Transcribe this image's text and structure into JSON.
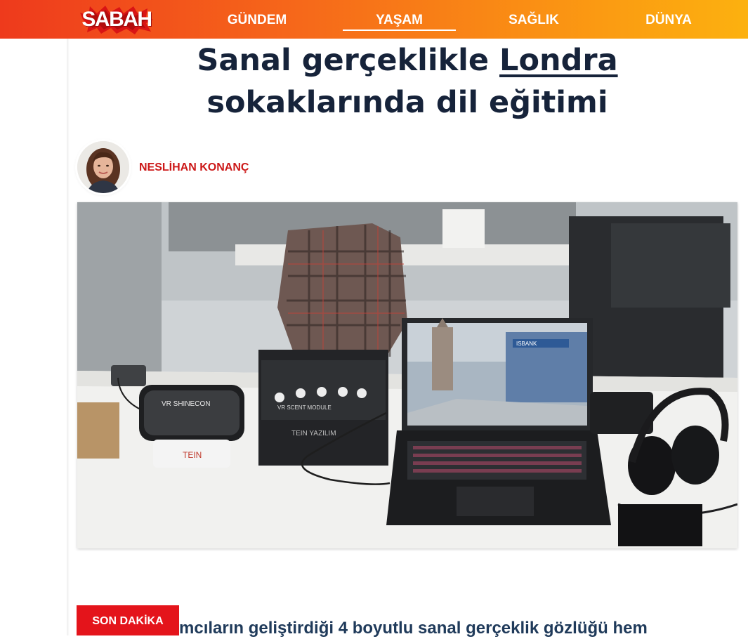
{
  "brand": {
    "logo_text": "SABAH",
    "colors": {
      "nav_start": "#ee3a1c",
      "nav_end": "#fcb10f",
      "headline": "#16233a",
      "author": "#cc1818",
      "badge": "#e4141b"
    }
  },
  "nav": {
    "items": [
      {
        "label": "GÜNDEM",
        "active": false
      },
      {
        "label": "YAŞAM",
        "active": true
      },
      {
        "label": "SAĞLIK",
        "active": false
      },
      {
        "label": "DÜNYA",
        "active": false
      }
    ]
  },
  "article": {
    "title_before": "Sanal gerçeklikle ",
    "title_link": "Londra",
    "title_after": " sokaklarında dil eğitimi",
    "author": "NESLİHAN KONANÇ",
    "image_texts": {
      "headset_brand": "VR SHINECON",
      "module_label": "VR SCENT MODULE",
      "module_brand": "TEIN YAZILIM",
      "logo_mark": "TEIN",
      "bank_sign": "ISBANK"
    },
    "lead_partial": "mcıların geliştirdiği 4 boyutlu sanal gerçeklik gözlüğü hem"
  },
  "badge": {
    "label": "SON DAKİKA"
  }
}
